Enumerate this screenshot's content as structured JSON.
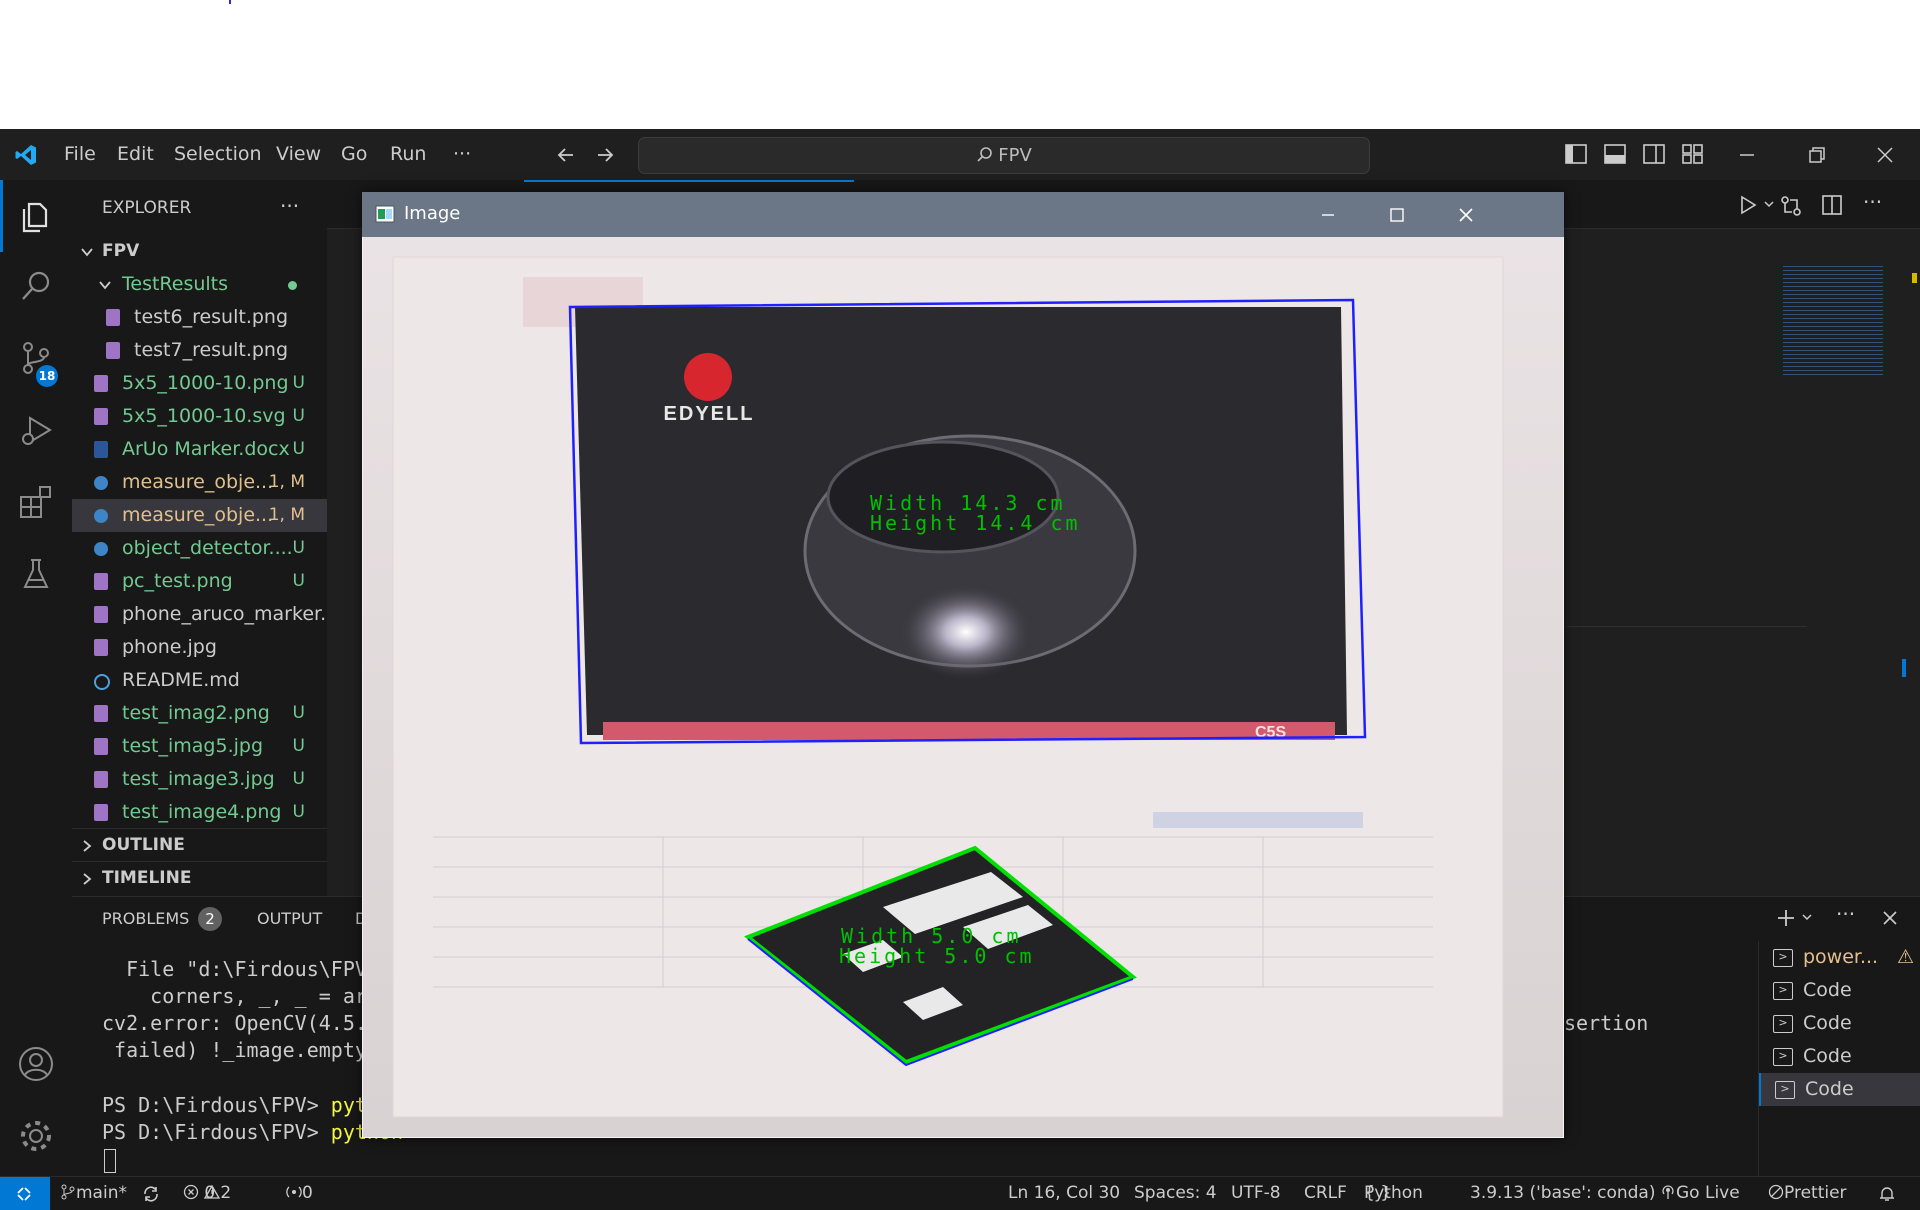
{
  "titlebar": {
    "menu": [
      "File",
      "Edit",
      "Selection",
      "View",
      "Go",
      "Run",
      "···"
    ],
    "search_text": "FPV"
  },
  "activity": {
    "source_control_badge": "18"
  },
  "explorer": {
    "header": "EXPLORER",
    "more": "···",
    "root": "FPV",
    "folder": "TestResults",
    "items": [
      {
        "name": "test6_result.png",
        "badge": "",
        "kind": "png",
        "color": "#cccccc",
        "indent": true
      },
      {
        "name": "test7_result.png",
        "badge": "",
        "kind": "png",
        "color": "#cccccc",
        "indent": true
      },
      {
        "name": "5x5_1000-10.png",
        "badge": "U",
        "kind": "png",
        "color": "#73c991"
      },
      {
        "name": "5x5_1000-10.svg",
        "badge": "U",
        "kind": "png",
        "color": "#73c991"
      },
      {
        "name": "ArUo Marker.docx",
        "badge": "U",
        "kind": "doc",
        "color": "#73c991"
      },
      {
        "name": "measure_obje...",
        "badge": "1, M",
        "kind": "py",
        "color": "#e2c08d"
      },
      {
        "name": "measure_obje...",
        "badge": "1, M",
        "kind": "py",
        "color": "#e2c08d",
        "selected": true
      },
      {
        "name": "object_detector....",
        "badge": "U",
        "kind": "py",
        "color": "#73c991"
      },
      {
        "name": "pc_test.png",
        "badge": "U",
        "kind": "png",
        "color": "#73c991"
      },
      {
        "name": "phone_aruco_marker....",
        "badge": "",
        "kind": "png",
        "color": "#cccccc"
      },
      {
        "name": "phone.jpg",
        "badge": "",
        "kind": "png",
        "color": "#cccccc"
      },
      {
        "name": "README.md",
        "badge": "",
        "kind": "info",
        "color": "#cccccc"
      },
      {
        "name": "test_imag2.png",
        "badge": "U",
        "kind": "png",
        "color": "#73c991"
      },
      {
        "name": "test_imag5.jpg",
        "badge": "U",
        "kind": "png",
        "color": "#73c991"
      },
      {
        "name": "test_image3.jpg",
        "badge": "U",
        "kind": "png",
        "color": "#73c991"
      },
      {
        "name": "test_image4.png",
        "badge": "U",
        "kind": "png",
        "color": "#73c991"
      }
    ],
    "outline": "OUTLINE",
    "timeline": "TIMELINE"
  },
  "panel": {
    "tabs": {
      "problems": "PROBLEMS",
      "problems_count": "2",
      "output": "OUTPUT",
      "debug_partial": "D"
    },
    "terminal_lines": [
      "  File \"d:\\Firdous\\FPV",
      "    corners, _, _ = ar",
      "cv2.error: OpenCV(4.5.",
      " failed) !_image.empty",
      "",
      "PS D:\\Firdous\\FPV> ",
      "PS D:\\Firdous\\FPV> "
    ],
    "cmd_partial_1": "pyt",
    "cmd_partial_2": "python",
    "right_fragment": "sertion",
    "terminals": [
      "power...",
      "Code",
      "Code",
      "Code",
      "Code"
    ]
  },
  "image_window": {
    "title": "Image",
    "box_label": "EDYELL",
    "box_model": "C5S",
    "object_width": "Width 14.3 cm",
    "object_height": "Height 14.4 cm",
    "marker_width": "Width 5.0 cm",
    "marker_height": "Height 5.0 cm"
  },
  "statusbar": {
    "branch": "main*",
    "errors": "0",
    "warnings": "2",
    "ports": "0",
    "position": "Ln 16, Col 30",
    "spaces": "Spaces: 4",
    "encoding": "UTF-8",
    "eol": "CRLF",
    "language": "Python",
    "interpreter": "3.9.13 ('base': conda)",
    "golive": "Go Live",
    "prettier": "Prettier"
  },
  "colors": {
    "accent": "#007acc",
    "remote": "#0078d4",
    "untracked": "#73c991",
    "modified": "#e2c08d",
    "detection_box": "#2020ff",
    "marker_outline": "#00e000",
    "label_text": "#00c000"
  }
}
